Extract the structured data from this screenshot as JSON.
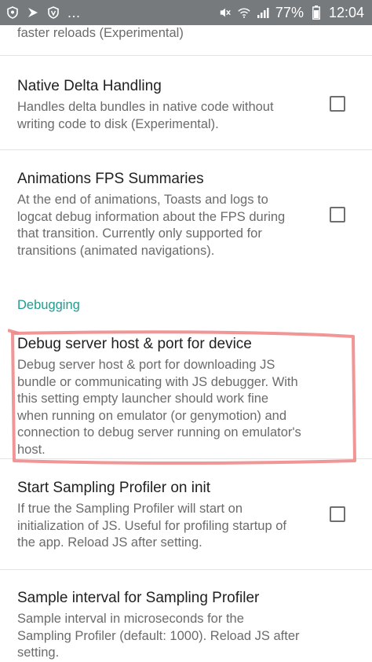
{
  "status_bar": {
    "left_icons": [
      "shield-icon",
      "flag-icon",
      "shield-icon",
      "more-icon"
    ],
    "more_text": "...",
    "right_icons": [
      "mute-icon",
      "wifi-icon",
      "signal-icon"
    ],
    "battery": "77%",
    "time": "12:04"
  },
  "top_partial": {
    "summary": "faster reloads (Experimental)"
  },
  "prefs": [
    {
      "title": "Native Delta Handling",
      "summary": "Handles delta bundles in native code without writing code to disk (Experimental).",
      "checked": false
    },
    {
      "title": "Animations FPS Summaries",
      "summary": "At the end of animations, Toasts and logs to logcat debug information about the FPS dur­ing that transition. Currently only supported for transitions (animated navigations).",
      "checked": false
    }
  ],
  "section": {
    "title": "Debugging"
  },
  "debug_pref": {
    "title": "Debug server host & port for device",
    "summary": "Debug server host & port for downloading JS bundle or communicating with JS debugger. With this setting empty launcher should work fine when running on emulator (or genymotion) and connection to debug server running on emulator's host."
  },
  "profiler_pref": {
    "title": "Start Sampling Profiler on init",
    "summary": "If true the Sampling Profiler will start on initialization of JS. Useful for profiling startup of the app. Reload JS after setting.",
    "checked": false
  },
  "interval_pref": {
    "title": "Sample interval for Sampling Profiler",
    "summary": "Sample interval in microseconds for the Sampling Profiler (default: 1000). Reload JS after setting."
  },
  "colors": {
    "status_bar": "#777a7c",
    "accent": "#1e9e8f",
    "highlight": "#f08a8a"
  }
}
